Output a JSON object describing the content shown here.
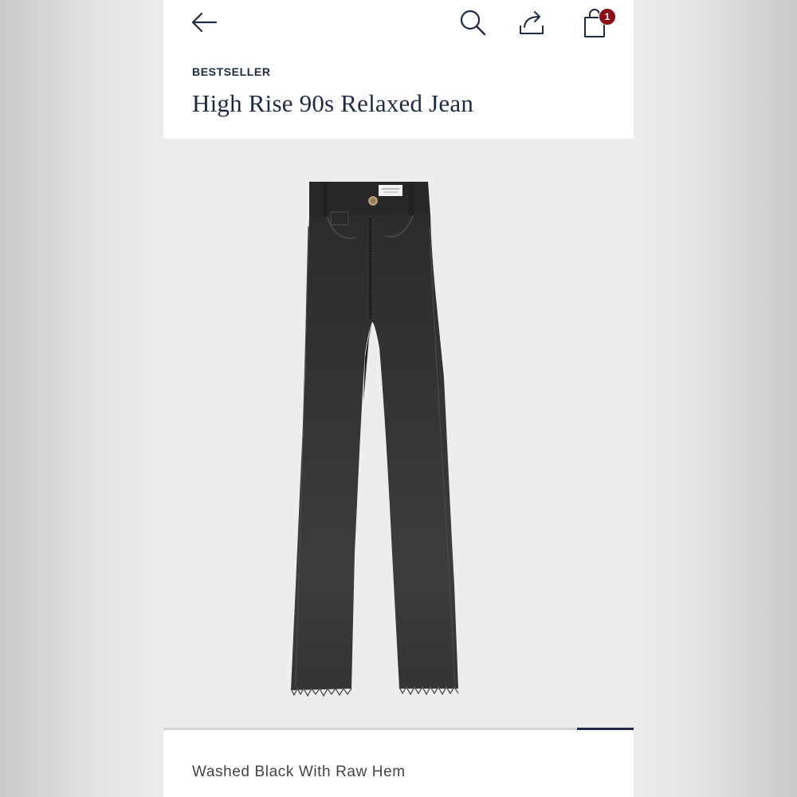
{
  "header": {
    "back_icon": "arrow-left-icon",
    "search_icon": "search-icon",
    "share_icon": "share-icon",
    "bag_icon": "shopping-bag-icon",
    "bag_count": "1",
    "accent_color": "#1f2a44",
    "badge_color": "#8d0d17"
  },
  "product": {
    "badge": "BESTSELLER",
    "title": "High Rise 90s Relaxed Jean",
    "image_subject": "black wide-leg jeans with raw hem",
    "color_name": "Washed Black With Raw Hem"
  },
  "gallery": {
    "progress_fraction": 0.12
  }
}
